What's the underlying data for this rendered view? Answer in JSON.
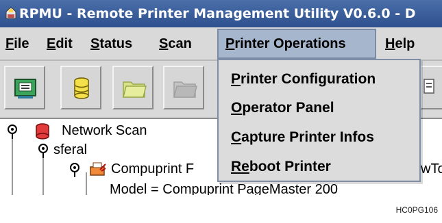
{
  "window": {
    "title": "RPMU - Remote Printer Management Utility V0.6.0 - D"
  },
  "menubar": {
    "items": [
      {
        "label": "File",
        "mnemonic": "F",
        "rest": "ile"
      },
      {
        "label": "Edit",
        "mnemonic": "E",
        "rest": "dit"
      },
      {
        "label": "Status",
        "mnemonic": "S",
        "rest": "tatus"
      },
      {
        "label": "Scan",
        "mnemonic": "S",
        "rest": "can"
      },
      {
        "label": "Printer Operations",
        "mnemonic": "P",
        "rest": "rinter Operations"
      },
      {
        "label": "Help",
        "mnemonic": "H",
        "rest": "elp"
      }
    ],
    "active": "Printer Operations"
  },
  "dropdown": {
    "items": [
      {
        "label": "Printer Configuration",
        "mnemonic": "P",
        "rest": "rinter Configuration"
      },
      {
        "label": "Operator Panel",
        "mnemonic": "O",
        "rest": "perator Panel"
      },
      {
        "label": "Capture Printer Infos",
        "mnemonic": "C",
        "rest": "apture Printer Infos"
      },
      {
        "label": "Reboot Printer",
        "mnemonic": "Re",
        "rest": "boot Printer"
      }
    ]
  },
  "toolbar": {
    "buttons": [
      {
        "icon": "network-printer-icon"
      },
      {
        "icon": "database-icon"
      },
      {
        "icon": "folder-icon"
      },
      {
        "icon": "folder-disabled-icon"
      },
      {
        "icon": "document-icon"
      }
    ]
  },
  "tree": {
    "root": "Network Scan",
    "child": "sferal",
    "grandchild": "Compuprint F",
    "grandchild_tail": "wTo",
    "leaf": "Model = Compuprint PageMaster 200"
  },
  "caption": "HC0PG106",
  "colors": {
    "titlebar": "#2e518f",
    "menu_active": "#a6b6cc",
    "menu_background": "#d9d9d9"
  }
}
